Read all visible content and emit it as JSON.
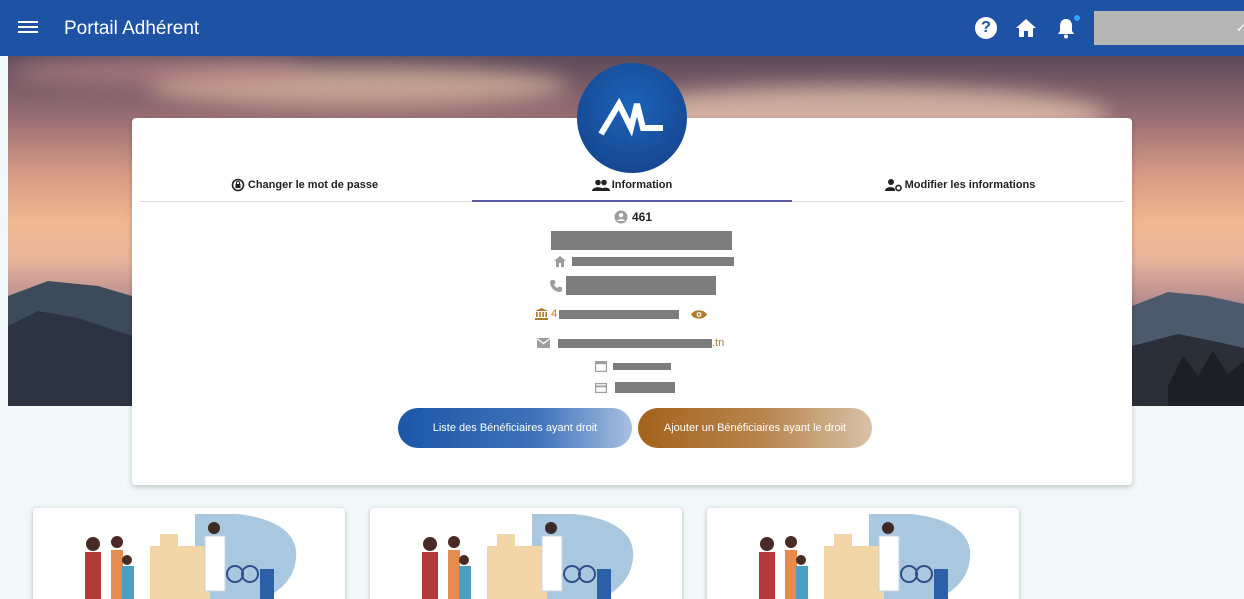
{
  "header": {
    "title": "Portail Adhérent",
    "icons": [
      "menu-icon",
      "help-icon",
      "home-icon",
      "bell-icon"
    ],
    "brand_color": "#1d52a4"
  },
  "tabs": [
    {
      "label": "Changer le mot de passe",
      "icon": "lock-reset-icon"
    },
    {
      "label": "Information",
      "icon": "people-icon",
      "active": true
    },
    {
      "label": "Modifier les informations",
      "icon": "user-cog-icon"
    }
  ],
  "profile": {
    "id": "461",
    "address_suffix": "",
    "bank_prefix": "4",
    "email_suffix": ".tn"
  },
  "actions": {
    "list_beneficiaries": "Liste des Bénéficiaires ayant droit",
    "add_beneficiary": "Ajouter un Bénéficiaires ayant le droit"
  },
  "colors": {
    "accent_blue": "#1c56a6",
    "accent_gold": "#a3621a",
    "tab_indicator": "#5a5aa8"
  }
}
